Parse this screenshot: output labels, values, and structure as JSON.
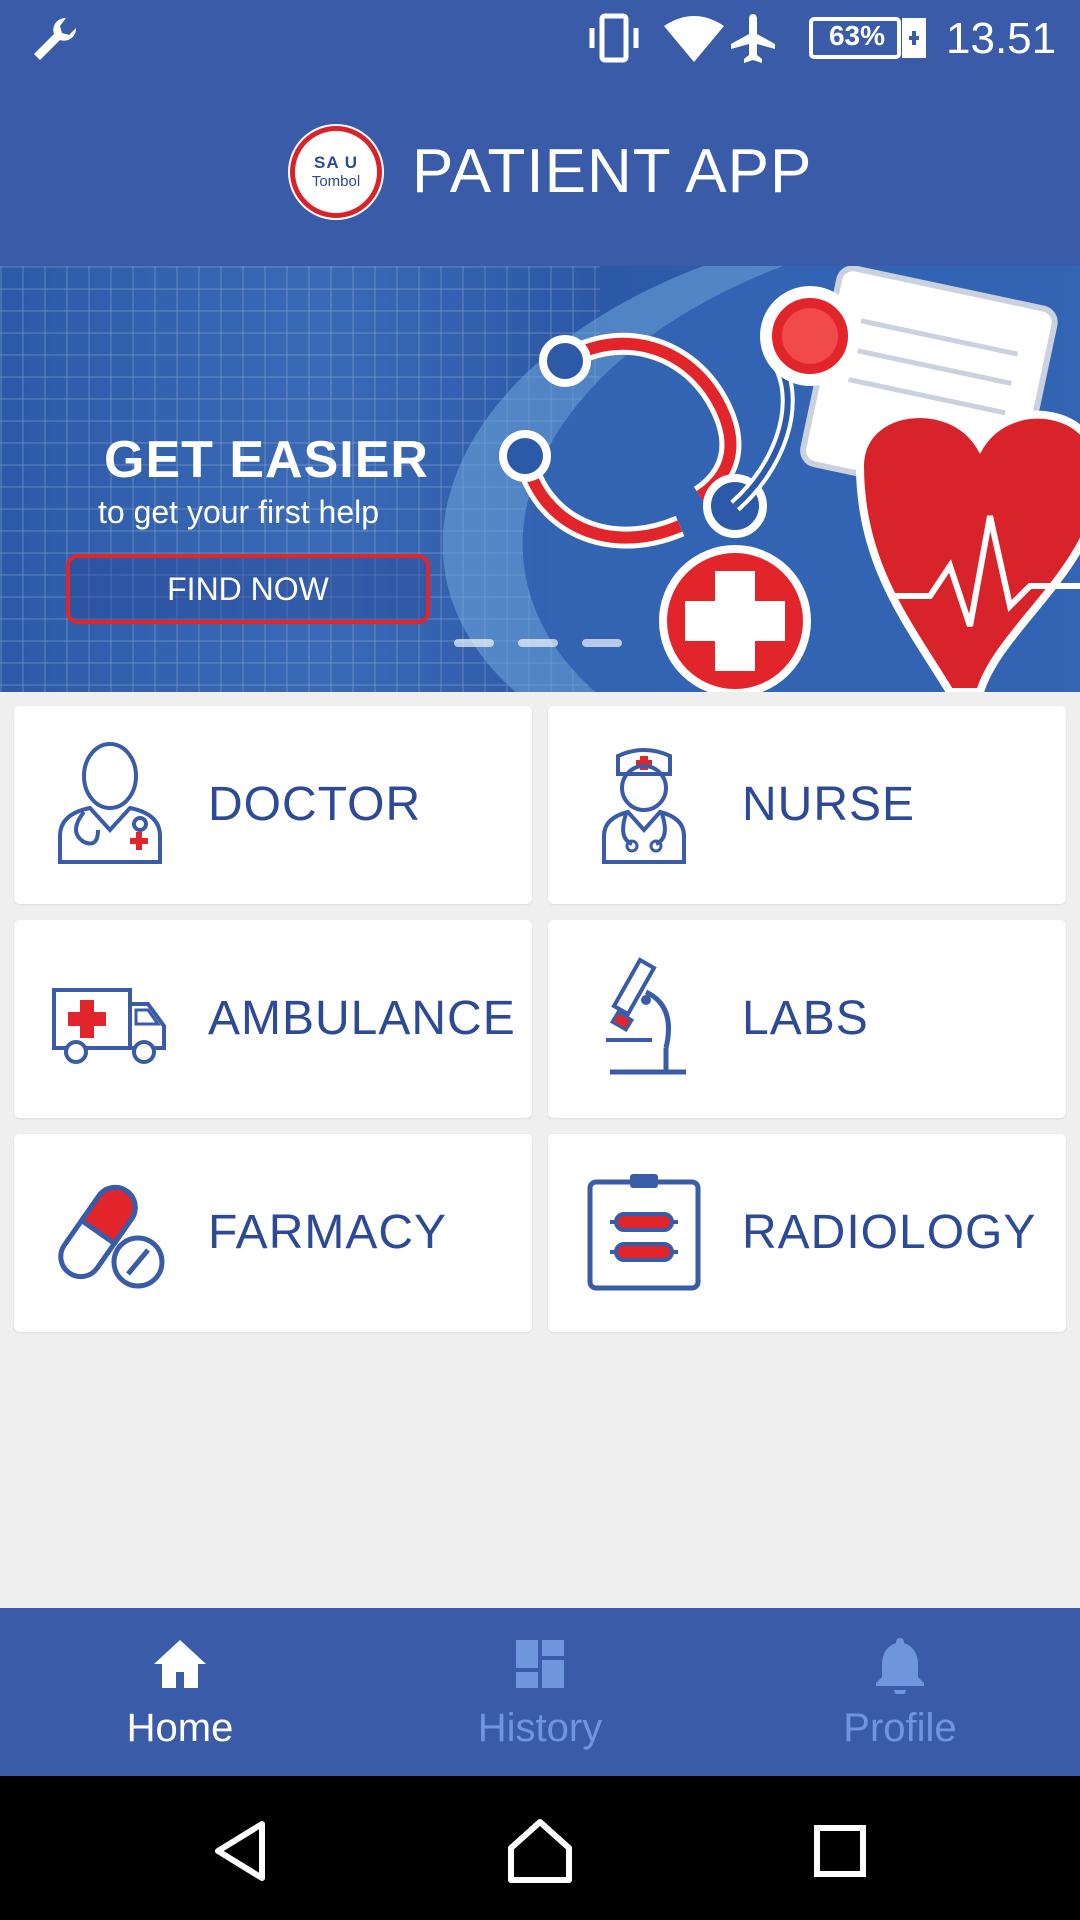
{
  "status_bar": {
    "battery": "63%",
    "time": "13.51",
    "icons": [
      "wrench-icon",
      "vibrate-icon",
      "wifi-icon",
      "airplane-icon",
      "battery-icon"
    ]
  },
  "header": {
    "logo_top": "SA U",
    "logo_bottom": "Tombol",
    "title": "PATIENT APP"
  },
  "banner": {
    "headline": "GET EASIER",
    "subline": "to get your first help",
    "button": "FIND NOW"
  },
  "menu": {
    "items": [
      {
        "label": "DOCTOR",
        "icon": "doctor-icon"
      },
      {
        "label": "NURSE",
        "icon": "nurse-icon"
      },
      {
        "label": "AMBULANCE",
        "icon": "ambulance-icon"
      },
      {
        "label": "LABS",
        "icon": "microscope-icon"
      },
      {
        "label": "FARMACY",
        "icon": "pill-icon"
      },
      {
        "label": "RADIOLOGY",
        "icon": "clipboard-icon"
      }
    ]
  },
  "bottom_nav": {
    "items": [
      {
        "label": "Home",
        "icon": "home-icon",
        "active": true
      },
      {
        "label": "History",
        "icon": "dashboard-icon",
        "active": false
      },
      {
        "label": "Profile",
        "icon": "bell-icon",
        "active": false
      }
    ]
  },
  "colors": {
    "primary": "#3a5ca8",
    "accent": "#e2242b",
    "label": "#2d4a96",
    "inactive_nav": "#6f96dd"
  }
}
